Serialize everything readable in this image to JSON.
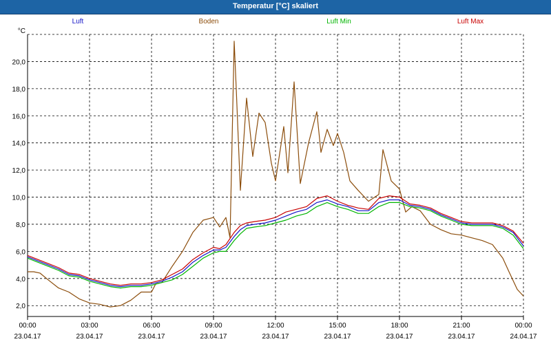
{
  "window": {
    "title": "Temperatur [°C] skaliert"
  },
  "chart_data": {
    "type": "line",
    "title": "Temperatur [°C] skaliert",
    "ylabel": "°C",
    "xlabel": "",
    "ylim": [
      1.2,
      22.0
    ],
    "xlim": [
      0,
      24
    ],
    "grid": true,
    "legend_position": "top",
    "y_ticks": [
      "2,0",
      "4,0",
      "6,0",
      "8,0",
      "10,0",
      "12,0",
      "14,0",
      "16,0",
      "18,0",
      "20,0"
    ],
    "x_ticks": [
      {
        "time": "00:00",
        "date": "23.04.17"
      },
      {
        "time": "03:00",
        "date": "23.04.17"
      },
      {
        "time": "06:00",
        "date": "23.04.17"
      },
      {
        "time": "09:00",
        "date": "23.04.17"
      },
      {
        "time": "12:00",
        "date": "23.04.17"
      },
      {
        "time": "15:00",
        "date": "23.04.17"
      },
      {
        "time": "18:00",
        "date": "23.04.17"
      },
      {
        "time": "21:00",
        "date": "23.04.17"
      },
      {
        "time": "00:00",
        "date": "24.04.17"
      }
    ],
    "series": [
      {
        "name": "Luft",
        "color": "#1515c8",
        "x": [
          0,
          0.5,
          1,
          1.5,
          2,
          2.5,
          3,
          3.5,
          4,
          4.5,
          5,
          5.5,
          6,
          6.5,
          7,
          7.5,
          8,
          8.5,
          9,
          9.3,
          9.6,
          10,
          10.3,
          10.6,
          11,
          11.5,
          12,
          12.5,
          13,
          13.5,
          14,
          14.5,
          15,
          15.5,
          16,
          16.5,
          17,
          17.5,
          18,
          18.5,
          19,
          19.5,
          20,
          20.5,
          21,
          21.5,
          22,
          22.5,
          23,
          23.5,
          24
        ],
        "values": [
          5.6,
          5.3,
          5.0,
          4.7,
          4.3,
          4.2,
          3.9,
          3.7,
          3.5,
          3.4,
          3.5,
          3.5,
          3.6,
          3.8,
          4.1,
          4.5,
          5.2,
          5.7,
          6.1,
          6.1,
          6.3,
          7.1,
          7.6,
          7.9,
          8.0,
          8.1,
          8.3,
          8.6,
          8.9,
          9.1,
          9.6,
          9.8,
          9.5,
          9.3,
          9.0,
          9.0,
          9.6,
          9.8,
          9.8,
          9.4,
          9.3,
          9.1,
          8.7,
          8.4,
          8.1,
          8.0,
          8.0,
          8.0,
          7.8,
          7.4,
          6.4
        ]
      },
      {
        "name": "Boden",
        "color": "#8b4c0a",
        "x": [
          0,
          0.3,
          0.6,
          1,
          1.5,
          2,
          2.5,
          3,
          3.5,
          4,
          4.5,
          5,
          5.5,
          6,
          6.2,
          6.5,
          7,
          7.5,
          8,
          8.5,
          9,
          9.3,
          9.6,
          9.8,
          10,
          10.1,
          10.3,
          10.6,
          10.9,
          11.2,
          11.5,
          11.8,
          12,
          12.4,
          12.6,
          12.9,
          13.2,
          13.6,
          14,
          14.2,
          14.5,
          14.8,
          15,
          15.3,
          15.6,
          16,
          16.5,
          17,
          17.2,
          17.6,
          18,
          18.3,
          18.6,
          19,
          19.5,
          20,
          20.5,
          21,
          21.5,
          22,
          22.5,
          23,
          23.3,
          23.7,
          24
        ],
        "values": [
          4.5,
          4.5,
          4.4,
          3.9,
          3.3,
          3.0,
          2.5,
          2.2,
          2.1,
          1.9,
          2.0,
          2.4,
          3.0,
          3.0,
          3.6,
          3.7,
          4.9,
          6.0,
          7.4,
          8.3,
          8.5,
          7.8,
          8.5,
          7.0,
          21.5,
          18.0,
          10.5,
          17.3,
          13.0,
          16.2,
          15.5,
          12.5,
          11.2,
          15.2,
          11.8,
          18.5,
          11.0,
          14.0,
          16.3,
          13.3,
          15.0,
          13.8,
          14.7,
          13.3,
          11.2,
          10.5,
          9.7,
          10.2,
          13.5,
          11.2,
          10.6,
          8.9,
          9.3,
          9.0,
          8.0,
          7.6,
          7.3,
          7.2,
          7.0,
          6.8,
          6.5,
          5.5,
          4.5,
          3.2,
          2.7
        ]
      },
      {
        "name": "Luft Min",
        "color": "#00b400",
        "x": [
          0,
          0.5,
          1,
          1.5,
          2,
          2.5,
          3,
          3.5,
          4,
          4.5,
          5,
          5.5,
          6,
          6.5,
          7,
          7.5,
          8,
          8.5,
          9,
          9.3,
          9.6,
          10,
          10.3,
          10.6,
          11,
          11.5,
          12,
          12.5,
          13,
          13.5,
          14,
          14.5,
          15,
          15.5,
          16,
          16.5,
          17,
          17.5,
          18,
          18.5,
          19,
          19.5,
          20,
          20.5,
          21,
          21.5,
          22,
          22.5,
          23,
          23.5,
          24
        ],
        "values": [
          5.5,
          5.2,
          4.9,
          4.6,
          4.2,
          4.1,
          3.8,
          3.6,
          3.4,
          3.3,
          3.4,
          3.4,
          3.5,
          3.7,
          3.9,
          4.3,
          4.9,
          5.5,
          5.9,
          6.0,
          6.0,
          6.8,
          7.3,
          7.7,
          7.8,
          7.9,
          8.1,
          8.3,
          8.6,
          8.8,
          9.3,
          9.6,
          9.3,
          9.1,
          8.8,
          8.8,
          9.3,
          9.6,
          9.6,
          9.3,
          9.2,
          9.0,
          8.6,
          8.3,
          8.0,
          7.9,
          7.9,
          7.9,
          7.7,
          7.2,
          6.2
        ]
      },
      {
        "name": "Luft Max",
        "color": "#c80000",
        "x": [
          0,
          0.5,
          1,
          1.5,
          2,
          2.5,
          3,
          3.5,
          4,
          4.5,
          5,
          5.5,
          6,
          6.5,
          7,
          7.5,
          8,
          8.5,
          9,
          9.3,
          9.6,
          10,
          10.3,
          10.6,
          11,
          11.5,
          12,
          12.5,
          13,
          13.5,
          14,
          14.5,
          15,
          15.5,
          16,
          16.5,
          17,
          17.5,
          18,
          18.5,
          19,
          19.5,
          20,
          20.5,
          21,
          21.5,
          22,
          22.5,
          23,
          23.5,
          24
        ],
        "values": [
          5.7,
          5.4,
          5.1,
          4.8,
          4.4,
          4.3,
          4.0,
          3.8,
          3.6,
          3.5,
          3.6,
          3.6,
          3.7,
          3.9,
          4.3,
          4.7,
          5.4,
          5.9,
          6.3,
          6.2,
          6.5,
          7.4,
          7.9,
          8.1,
          8.2,
          8.3,
          8.5,
          8.9,
          9.1,
          9.3,
          9.9,
          10.1,
          9.7,
          9.4,
          9.2,
          9.1,
          9.9,
          10.1,
          10.0,
          9.5,
          9.4,
          9.2,
          8.8,
          8.5,
          8.2,
          8.1,
          8.1,
          8.1,
          7.9,
          7.5,
          6.6
        ]
      }
    ]
  }
}
